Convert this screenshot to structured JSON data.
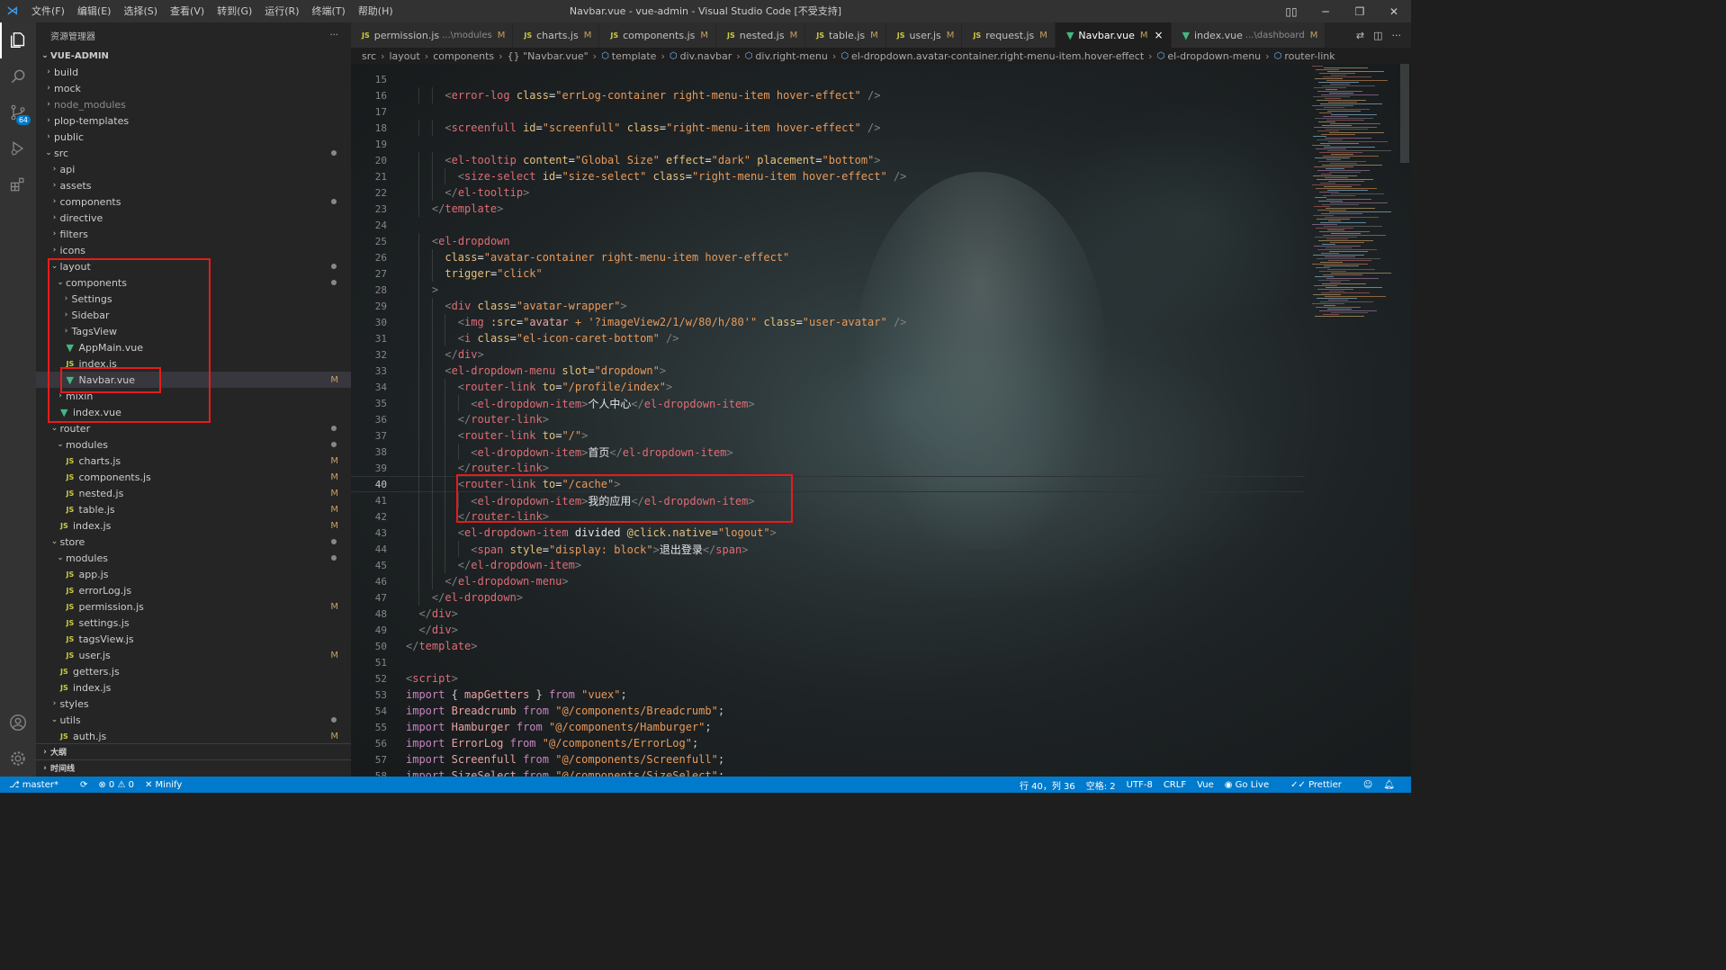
{
  "title_bar": {
    "menus": [
      "文件(F)",
      "编辑(E)",
      "选择(S)",
      "查看(V)",
      "转到(G)",
      "运行(R)",
      "终端(T)",
      "帮助(H)"
    ],
    "window_title": "Navbar.vue - vue-admin - Visual Studio Code [不受支持]"
  },
  "activity_bar": {
    "scm_badge": "64"
  },
  "explorer": {
    "header": "资源管理器",
    "project": "VUE-ADMIN",
    "rows": [
      {
        "label": "build",
        "type": "folder",
        "open": false,
        "depth": 1
      },
      {
        "label": "mock",
        "type": "folder",
        "open": false,
        "depth": 1
      },
      {
        "label": "node_modules",
        "type": "folder",
        "open": false,
        "depth": 1,
        "dim": true
      },
      {
        "label": "plop-templates",
        "type": "folder",
        "open": false,
        "depth": 1
      },
      {
        "label": "public",
        "type": "folder",
        "open": false,
        "depth": 1
      },
      {
        "label": "src",
        "type": "folder",
        "open": true,
        "depth": 1,
        "dot": true
      },
      {
        "label": "api",
        "type": "folder",
        "open": false,
        "depth": 2
      },
      {
        "label": "assets",
        "type": "folder",
        "open": false,
        "depth": 2
      },
      {
        "label": "components",
        "type": "folder",
        "open": false,
        "depth": 2,
        "dot": true
      },
      {
        "label": "directive",
        "type": "folder",
        "open": false,
        "depth": 2
      },
      {
        "label": "filters",
        "type": "folder",
        "open": false,
        "depth": 2
      },
      {
        "label": "icons",
        "type": "folder",
        "open": false,
        "depth": 2
      },
      {
        "label": "layout",
        "type": "folder",
        "open": true,
        "depth": 2,
        "dot": true
      },
      {
        "label": "components",
        "type": "folder",
        "open": true,
        "depth": 3,
        "dot": true
      },
      {
        "label": "Settings",
        "type": "folder",
        "open": false,
        "depth": 4
      },
      {
        "label": "Sidebar",
        "type": "folder",
        "open": false,
        "depth": 4
      },
      {
        "label": "TagsView",
        "type": "folder",
        "open": false,
        "depth": 4
      },
      {
        "label": "AppMain.vue",
        "type": "vue",
        "depth": 4
      },
      {
        "label": "index.js",
        "type": "js",
        "depth": 4
      },
      {
        "label": "Navbar.vue",
        "type": "vue",
        "depth": 4,
        "mark": "M",
        "selected": true
      },
      {
        "label": "mixin",
        "type": "folder",
        "open": false,
        "depth": 3
      },
      {
        "label": "index.vue",
        "type": "vue",
        "depth": 3
      },
      {
        "label": "router",
        "type": "folder",
        "open": true,
        "depth": 2,
        "dot": true
      },
      {
        "label": "modules",
        "type": "folder",
        "open": true,
        "depth": 3,
        "dot": true
      },
      {
        "label": "charts.js",
        "type": "js",
        "depth": 4,
        "mark": "M"
      },
      {
        "label": "components.js",
        "type": "js",
        "depth": 4,
        "mark": "M"
      },
      {
        "label": "nested.js",
        "type": "js",
        "depth": 4,
        "mark": "M"
      },
      {
        "label": "table.js",
        "type": "js",
        "depth": 4,
        "mark": "M"
      },
      {
        "label": "index.js",
        "type": "js",
        "depth": 3,
        "mark": "M"
      },
      {
        "label": "store",
        "type": "folder",
        "open": true,
        "depth": 2,
        "dot": true
      },
      {
        "label": "modules",
        "type": "folder",
        "open": true,
        "depth": 3,
        "dot": true
      },
      {
        "label": "app.js",
        "type": "js",
        "depth": 4
      },
      {
        "label": "errorLog.js",
        "type": "js",
        "depth": 4
      },
      {
        "label": "permission.js",
        "type": "js",
        "depth": 4,
        "mark": "M"
      },
      {
        "label": "settings.js",
        "type": "js",
        "depth": 4
      },
      {
        "label": "tagsView.js",
        "type": "js",
        "depth": 4
      },
      {
        "label": "user.js",
        "type": "js",
        "depth": 4,
        "mark": "M"
      },
      {
        "label": "getters.js",
        "type": "js",
        "depth": 3
      },
      {
        "label": "index.js",
        "type": "js",
        "depth": 3
      },
      {
        "label": "styles",
        "type": "folder",
        "open": false,
        "depth": 2
      },
      {
        "label": "utils",
        "type": "folder",
        "open": true,
        "depth": 2,
        "dot": true
      },
      {
        "label": "auth.js",
        "type": "js",
        "depth": 3,
        "mark": "M"
      }
    ],
    "outline_label": "大纲",
    "timeline_label": "时间线"
  },
  "tabs": [
    {
      "label": "permission.js",
      "desc": "...\\modules",
      "mod": "M",
      "type": "js"
    },
    {
      "label": "charts.js",
      "desc": "",
      "mod": "M",
      "type": "js"
    },
    {
      "label": "components.js",
      "desc": "",
      "mod": "M",
      "type": "js"
    },
    {
      "label": "nested.js",
      "desc": "",
      "mod": "M",
      "type": "js"
    },
    {
      "label": "table.js",
      "desc": "",
      "mod": "M",
      "type": "js"
    },
    {
      "label": "user.js",
      "desc": "",
      "mod": "M",
      "type": "js"
    },
    {
      "label": "request.js",
      "desc": "",
      "mod": "M",
      "type": "js"
    },
    {
      "label": "Navbar.vue",
      "desc": "",
      "mod": "M",
      "type": "vue",
      "active": true
    },
    {
      "label": "index.vue",
      "desc": "...\\dashboard",
      "mod": "M",
      "type": "vue"
    }
  ],
  "breadcrumb": [
    "src",
    "layout",
    "components",
    "{} \"Navbar.vue\"",
    "template",
    "div.navbar",
    "div.right-menu",
    "el-dropdown.avatar-container.right-menu-item.hover-effect",
    "el-dropdown-menu",
    "router-link"
  ],
  "editor": {
    "current_line": 40,
    "lines": [
      {
        "n": 15,
        "t": ""
      },
      {
        "n": 16,
        "t": "      <error-log class=\"errLog-container right-menu-item hover-effect\" />"
      },
      {
        "n": 17,
        "t": ""
      },
      {
        "n": 18,
        "t": "      <screenfull id=\"screenfull\" class=\"right-menu-item hover-effect\" />"
      },
      {
        "n": 19,
        "t": ""
      },
      {
        "n": 20,
        "t": "      <el-tooltip content=\"Global Size\" effect=\"dark\" placement=\"bottom\">"
      },
      {
        "n": 21,
        "t": "        <size-select id=\"size-select\" class=\"right-menu-item hover-effect\" />"
      },
      {
        "n": 22,
        "t": "      </el-tooltip>"
      },
      {
        "n": 23,
        "t": "    </template>"
      },
      {
        "n": 24,
        "t": ""
      },
      {
        "n": 25,
        "t": "    <el-dropdown"
      },
      {
        "n": 26,
        "t": "      class=\"avatar-container right-menu-item hover-effect\""
      },
      {
        "n": 27,
        "t": "      trigger=\"click\""
      },
      {
        "n": 28,
        "t": "    >"
      },
      {
        "n": 29,
        "t": "      <div class=\"avatar-wrapper\">"
      },
      {
        "n": 30,
        "t": "        <img :src=\"avatar + '?imageView2/1/w/80/h/80'\" class=\"user-avatar\" />"
      },
      {
        "n": 31,
        "t": "        <i class=\"el-icon-caret-bottom\" />"
      },
      {
        "n": 32,
        "t": "      </div>"
      },
      {
        "n": 33,
        "t": "      <el-dropdown-menu slot=\"dropdown\">"
      },
      {
        "n": 34,
        "t": "        <router-link to=\"/profile/index\">"
      },
      {
        "n": 35,
        "t": "          <el-dropdown-item>个人中心</el-dropdown-item>"
      },
      {
        "n": 36,
        "t": "        </router-link>"
      },
      {
        "n": 37,
        "t": "        <router-link to=\"/\">"
      },
      {
        "n": 38,
        "t": "          <el-dropdown-item>首页</el-dropdown-item>"
      },
      {
        "n": 39,
        "t": "        </router-link>"
      },
      {
        "n": 40,
        "t": "        <router-link to=\"/cache\">"
      },
      {
        "n": 41,
        "t": "          <el-dropdown-item>我的应用</el-dropdown-item>"
      },
      {
        "n": 42,
        "t": "        </router-link>"
      },
      {
        "n": 43,
        "t": "        <el-dropdown-item divided @click.native=\"logout\">"
      },
      {
        "n": 44,
        "t": "          <span style=\"display: block\">退出登录</span>"
      },
      {
        "n": 45,
        "t": "        </el-dropdown-item>"
      },
      {
        "n": 46,
        "t": "      </el-dropdown-menu>"
      },
      {
        "n": 47,
        "t": "    </el-dropdown>"
      },
      {
        "n": 48,
        "t": "  </div>"
      },
      {
        "n": 49,
        "t": "  </div>"
      },
      {
        "n": 50,
        "t": "</template>"
      },
      {
        "n": 51,
        "t": ""
      },
      {
        "n": 52,
        "t": "<script>"
      },
      {
        "n": 53,
        "t": "import { mapGetters } from \"vuex\";"
      },
      {
        "n": 54,
        "t": "import Breadcrumb from \"@/components/Breadcrumb\";"
      },
      {
        "n": 55,
        "t": "import Hamburger from \"@/components/Hamburger\";"
      },
      {
        "n": 56,
        "t": "import ErrorLog from \"@/components/ErrorLog\";"
      },
      {
        "n": 57,
        "t": "import Screenfull from \"@/components/Screenfull\";"
      },
      {
        "n": 58,
        "t": "import SizeSelect from \"@/components/SizeSelect\";"
      }
    ]
  },
  "status_bar": {
    "branch": "master*",
    "problems": "⊗ 0 ⚠ 0",
    "minify": "Minify",
    "cursor": "行 40，列 36",
    "indent": "空格: 2",
    "encoding": "UTF-8",
    "eol": "CRLF",
    "language": "Vue",
    "golive": "Go Live",
    "prettier": "Prettier"
  }
}
